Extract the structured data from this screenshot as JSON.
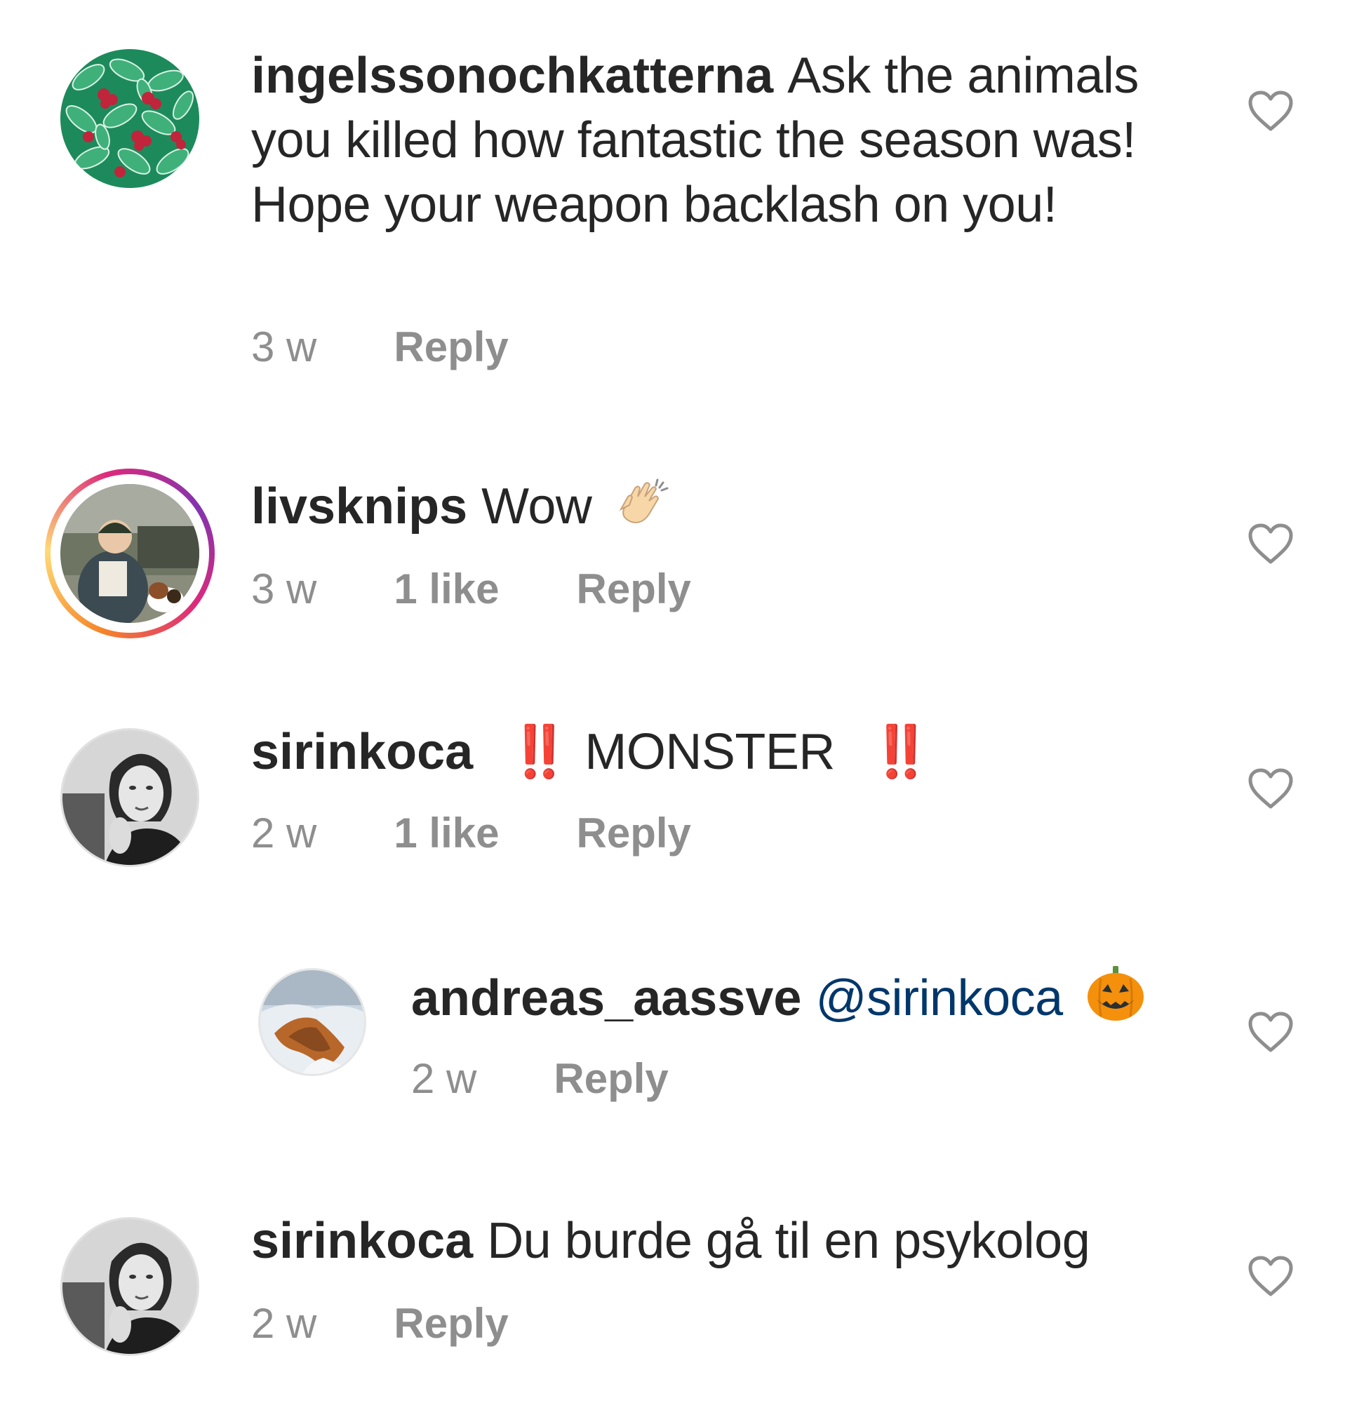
{
  "comments": [
    {
      "username": "ingelssonochkatterna",
      "text": "Ask the animals you killed how fantastic the season was! Hope your weapon backlash on you!",
      "time": "3 w",
      "reply_label": "Reply",
      "avatar_icon": "berry-leaf-pattern-avatar"
    },
    {
      "username": "livsknips",
      "text": "Wow",
      "emoji": "clapping-hands",
      "time": "3 w",
      "likes": "1 like",
      "reply_label": "Reply",
      "avatar_icon": "person-with-dog-avatar",
      "has_story_ring": true
    },
    {
      "username": "sirinkoca",
      "text_parts": [
        "‼️",
        "MONSTER",
        "‼️"
      ],
      "time": "2 w",
      "likes": "1 like",
      "reply_label": "Reply",
      "avatar_icon": "woman-portrait-avatar"
    },
    {
      "username": "andreas_aassve",
      "mention": "@sirinkoca",
      "emoji": "jack-o-lantern",
      "time": "2 w",
      "reply_label": "Reply",
      "avatar_icon": "snowy-mountain-avatar",
      "is_reply": true
    },
    {
      "username": "sirinkoca",
      "text": "Du burde gå til en psykolog",
      "time": "2 w",
      "reply_label": "Reply",
      "avatar_icon": "woman-portrait-avatar"
    }
  ],
  "colors": {
    "text": "#262626",
    "meta": "#8e8e8e",
    "mention": "#00376b",
    "heart_outline": "#8e8e8e",
    "exclamation_red": "#dd2e44",
    "pumpkin": "#f4900c"
  }
}
